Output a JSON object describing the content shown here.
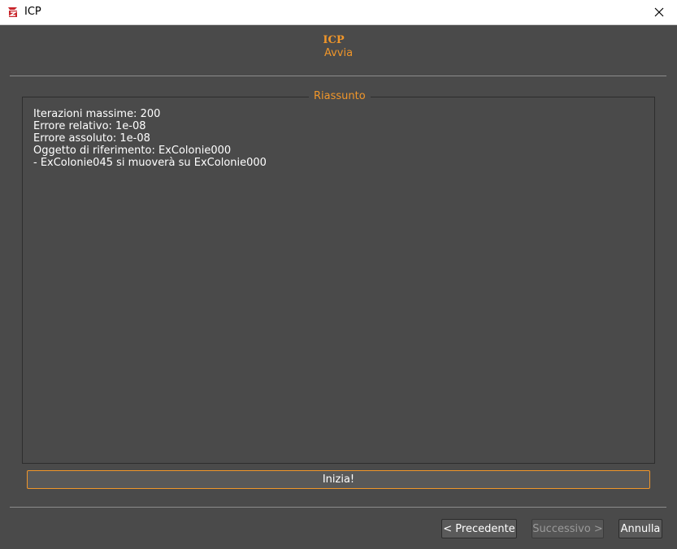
{
  "window": {
    "title": "ICP",
    "icon": "app-logo-icon",
    "close_icon": "close-icon"
  },
  "header": {
    "title": "ICP",
    "subtitle": "Avvia"
  },
  "summary": {
    "legend": "Riassunto",
    "lines": [
      "Iterazioni massime: 200",
      "Errore relativo: 1e-08",
      "Errore assoluto: 1e-08",
      "Oggetto di riferimento: ExColonie000",
      "- ExColonie045 si muoverà su ExColonie000"
    ]
  },
  "actions": {
    "start_label": "Inizia!"
  },
  "nav": {
    "previous_label": "< Precedente",
    "next_label": "Successivo >",
    "cancel_label": "Annulla"
  },
  "colors": {
    "accent": "#f0962a",
    "background": "#4a4a4a",
    "text": "#ffffff"
  }
}
